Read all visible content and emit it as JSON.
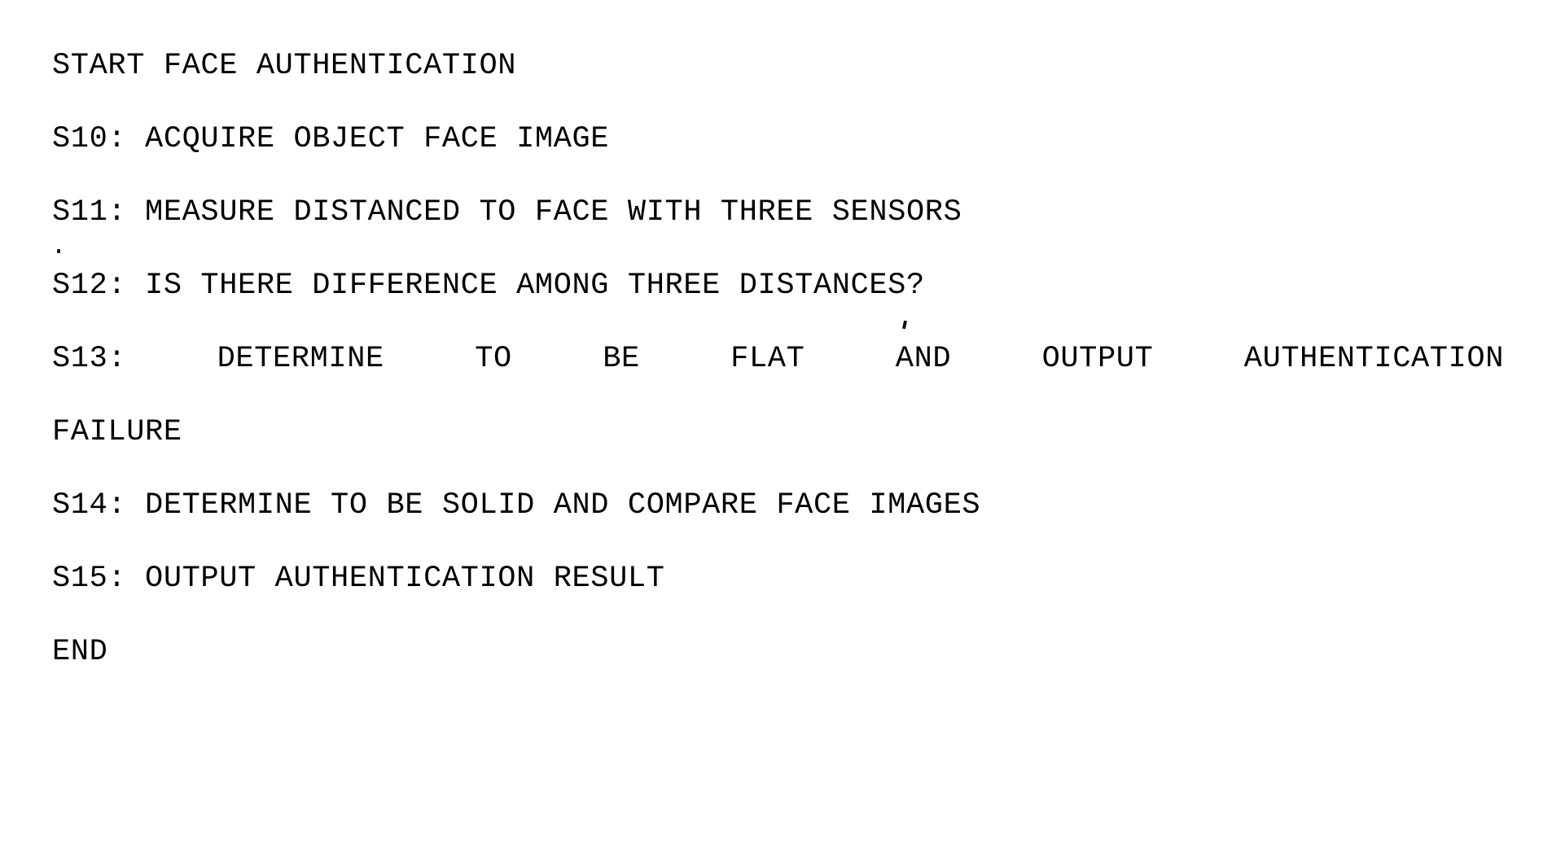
{
  "document": {
    "kind": "flowchart-step-list",
    "background_color": "#ffffff",
    "text_color": "#000000",
    "lines": [
      {
        "id": "start",
        "text": "START FACE AUTHENTICATION",
        "justified": false
      },
      {
        "id": "s10",
        "step": "S10",
        "text": "S10: ACQUIRE OBJECT FACE IMAGE",
        "justified": false
      },
      {
        "id": "s11",
        "step": "S11",
        "text": "S11: MEASURE DISTANCED TO FACE WITH THREE SENSORS",
        "justified": false
      },
      {
        "id": "s12",
        "step": "S12",
        "text": "S12: IS THERE DIFFERENCE AMONG THREE DISTANCES?",
        "justified": false
      },
      {
        "id": "s13",
        "step": "S13",
        "text": "S13:  DETERMINE  TO  BE  FLAT  AND  OUTPUT  AUTHENTICATION",
        "justified": true
      },
      {
        "id": "s13-continuation",
        "text": "FAILURE",
        "justified": false
      },
      {
        "id": "s14",
        "step": "S14",
        "text": "S14: DETERMINE TO BE SOLID AND COMPARE FACE IMAGES",
        "justified": false
      },
      {
        "id": "s15",
        "step": "S15",
        "text": "S15: OUTPUT AUTHENTICATION RESULT",
        "justified": false
      },
      {
        "id": "end",
        "text": "END",
        "justified": false
      }
    ],
    "justified_line_words": [
      "S13:",
      "DETERMINE",
      "TO",
      "BE",
      "FLAT",
      "AND",
      "OUTPUT",
      "AUTHENTICATION"
    ]
  }
}
